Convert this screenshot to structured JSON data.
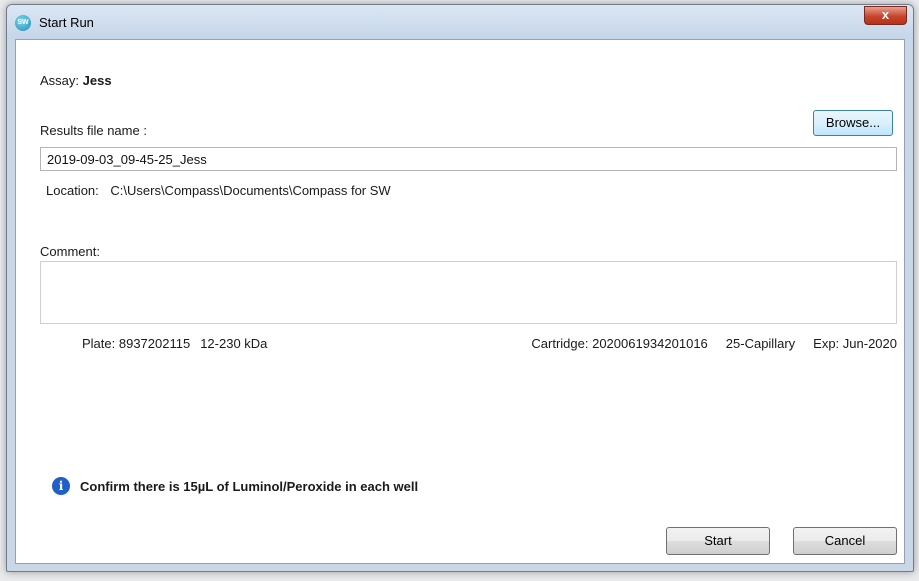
{
  "window": {
    "title": "Start Run",
    "app_icon_text": "SW",
    "close_label": "x"
  },
  "assay": {
    "label": "Assay:",
    "value": "Jess"
  },
  "results": {
    "label": "Results file name :",
    "browse_label": "Browse...",
    "file_name": "2019-09-03_09-45-25_Jess"
  },
  "location": {
    "label": "Location:",
    "path": "C:\\Users\\Compass\\Documents\\Compass for SW"
  },
  "comment": {
    "label": "Comment:",
    "value": ""
  },
  "plate": {
    "id": "Plate: 8937202115",
    "range": "12-230 kDa"
  },
  "cartridge": {
    "id": "Cartridge: 2020061934201016",
    "type": "25-Capillary",
    "exp": "Exp: Jun-2020"
  },
  "info": {
    "icon": "info-icon",
    "message": "Confirm there is 15µL of Luminol/Peroxide in each well"
  },
  "buttons": {
    "start": "Start",
    "cancel": "Cancel"
  },
  "colors": {
    "info_icon": "#1e5fc8",
    "close_button": "#c7452c"
  }
}
